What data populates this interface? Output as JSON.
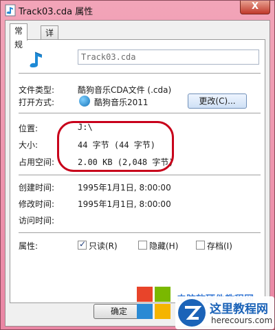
{
  "window": {
    "title": "Track03.cda 属性",
    "close_glyph": "X"
  },
  "tabs": [
    {
      "label": "常规"
    },
    {
      "label": "详细信息"
    }
  ],
  "file": {
    "name": "Track03.cda"
  },
  "properties": {
    "type_label": "文件类型:",
    "type_value": "酷狗音乐CDA文件 (.cda)",
    "open_label": "打开方式:",
    "open_value": "酷狗音乐2011",
    "change_button": "更改(C)...",
    "location_label": "位置:",
    "location_value": "J:\\",
    "size_label": "大小:",
    "size_value": "44 字节 (44 字节)",
    "disk_label": "占用空间:",
    "disk_value": "2.00 KB (2,048 字节)",
    "created_label": "创建时间:",
    "created_value": "1995年1月1日, 8:00:00",
    "modified_label": "修改时间:",
    "modified_value": "1995年1月1日, 8:00:00",
    "accessed_label": "访问时间:",
    "accessed_value": "",
    "attributes_label": "属性:",
    "attributes": [
      {
        "label": "只读(R)",
        "checked": true
      },
      {
        "label": "隐藏(H)",
        "checked": false
      },
      {
        "label": "存档(I)",
        "checked": false
      }
    ]
  },
  "buttons": {
    "ok": "确定"
  },
  "watermark": {
    "text": "电脑软硬件教程网",
    "name": "这里教程网",
    "url": "herecours.com"
  },
  "colors": {
    "title_bar": "#ea86a4",
    "highlight": "#c8001a"
  }
}
